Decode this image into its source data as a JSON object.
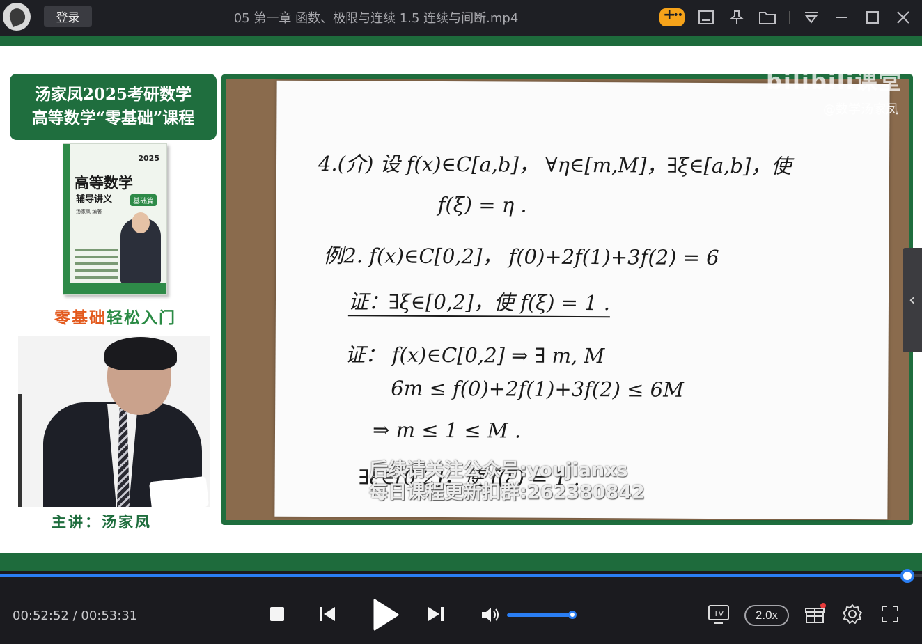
{
  "titlebar": {
    "login_label": "登录",
    "window_title": "05 第一章 函数、极限与连续 1.5 连续与间断.mp4"
  },
  "video": {
    "course_title_line1": "汤家凤2025考研数学",
    "course_title_line2": "高等数学“零基础”课程",
    "book": {
      "year": "2025",
      "title": "高等数学",
      "subtitle": "辅导讲义",
      "tag": "基础篇",
      "author": "汤家凤 编著"
    },
    "slogan_part1": "零基础",
    "slogan_part2": "轻松入门",
    "presenter": "主讲：汤家凤",
    "watermark_logo": "bilibili课堂",
    "watermark_user": "@数学汤家凤",
    "promo_line1": "后续请关注公众号:youjianxs",
    "promo_line2": "每日课程更新扣群:262380842",
    "notes": {
      "line1": "4.(介) 设 f(x)∈C[a,b]， ∀η∈[m,M]，∃ξ∈[a,b]，使",
      "line2": "f(ξ) = η .",
      "line3": "例2.  f(x)∈C[0,2]， f(0)+2f(1)+3f(2) = 6",
      "line4": "证：∃ξ∈[0,2]，使 f(ξ) = 1 .",
      "line5": "证：  f(x)∈C[0,2]   ⇒ ∃ m, M",
      "line6": "6m ≤ f(0)+2f(1)+3f(2) ≤ 6M",
      "line7": "⇒ m ≤ 1 ≤ M .",
      "line8": "∃ξ∈[0,2]，使 f(ξ) = 1 ."
    }
  },
  "player": {
    "current_time": "00:52:52",
    "separator": "/",
    "total_time": "00:53:31",
    "progress_fraction": 0.9838,
    "volume_fraction": 1.0,
    "speed_label": "2.0x",
    "tv_label": "TV"
  },
  "colors": {
    "accent": "#2a7ef3",
    "brand_green": "#1f6e3e",
    "background": "#1b1b1f"
  }
}
